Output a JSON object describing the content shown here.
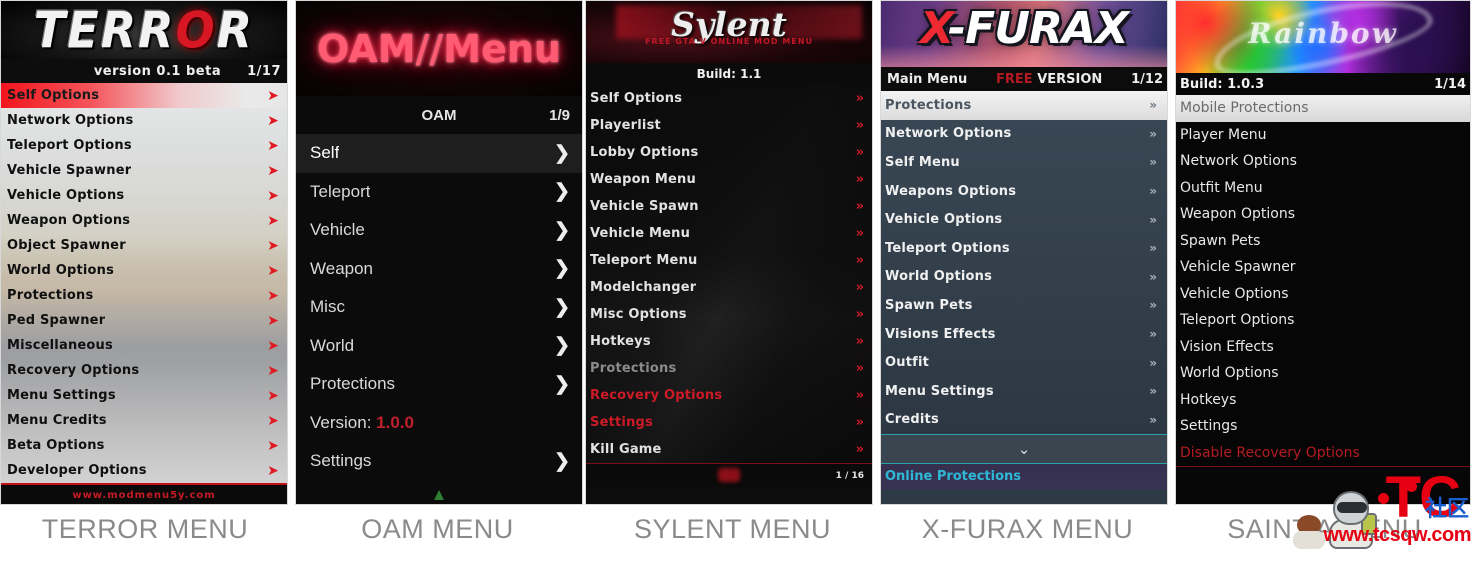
{
  "page": {
    "watermark": {
      "brand": "TC",
      "brand_cn": "社区",
      "url": "www.tcsqw.com"
    }
  },
  "panels": [
    {
      "id": "terror",
      "caption": "TERROR MENU",
      "logo": {
        "pre": "TERR",
        "accent": "O",
        "post": "R"
      },
      "header": {
        "version": "version 0.1 beta",
        "page": "1/17"
      },
      "footer": "www.modmenu5y.com",
      "items": [
        {
          "label": "Self Options",
          "arrow": "➤",
          "selected": true
        },
        {
          "label": "Network Options",
          "arrow": "➤",
          "selected": false
        },
        {
          "label": "Teleport Options",
          "arrow": "➤",
          "selected": false
        },
        {
          "label": "Vehicle Spawner",
          "arrow": "➤",
          "selected": false
        },
        {
          "label": "Vehicle Options",
          "arrow": "➤",
          "selected": false
        },
        {
          "label": "Weapon Options",
          "arrow": "➤",
          "selected": false
        },
        {
          "label": "Object Spawner",
          "arrow": "➤",
          "selected": false
        },
        {
          "label": "World Options",
          "arrow": "➤",
          "selected": false
        },
        {
          "label": "Protections",
          "arrow": "➤",
          "selected": false
        },
        {
          "label": "Ped Spawner",
          "arrow": "➤",
          "selected": false
        },
        {
          "label": "Miscellaneous",
          "arrow": "➤",
          "selected": false
        },
        {
          "label": "Recovery Options",
          "arrow": "➤",
          "selected": false
        },
        {
          "label": "Menu Settings",
          "arrow": "➤",
          "selected": false
        },
        {
          "label": "Menu Credits",
          "arrow": "➤",
          "selected": false
        },
        {
          "label": "Beta Options",
          "arrow": "➤",
          "selected": false
        },
        {
          "label": "Developer Options",
          "arrow": "➤",
          "selected": false
        }
      ]
    },
    {
      "id": "oam",
      "caption": "OAM MENU",
      "logo": "OAM//Menu",
      "header": {
        "title": "OAM",
        "page": "1/9"
      },
      "footer_glyph": "▲",
      "items": [
        {
          "label": "Self",
          "arrow": "❯",
          "selected": true
        },
        {
          "label": "Teleport",
          "arrow": "❯",
          "selected": false
        },
        {
          "label": "Vehicle",
          "arrow": "❯",
          "selected": false
        },
        {
          "label": "Weapon",
          "arrow": "❯",
          "selected": false
        },
        {
          "label": "Misc",
          "arrow": "❯",
          "selected": false
        },
        {
          "label": "World",
          "arrow": "❯",
          "selected": false
        },
        {
          "label": "Protections",
          "arrow": "❯",
          "selected": false
        },
        {
          "label": "Version:",
          "value": "1.0.0",
          "arrow": "",
          "selected": false
        },
        {
          "label": "Settings",
          "arrow": "❯",
          "selected": false
        }
      ]
    },
    {
      "id": "sylent",
      "caption": "SYLENT MENU",
      "logo": "Sylent",
      "tagline": "FREE GTA V ONLINE MOD MENU",
      "header": {
        "build": "Build: 1.1"
      },
      "footer": {
        "page": "1 / 16"
      },
      "items": [
        {
          "label": "Self Options",
          "arrow": "»",
          "style": "normal"
        },
        {
          "label": "Playerlist",
          "arrow": "»",
          "style": "normal"
        },
        {
          "label": "Lobby Options",
          "arrow": "»",
          "style": "normal"
        },
        {
          "label": "Weapon Menu",
          "arrow": "»",
          "style": "normal"
        },
        {
          "label": "Vehicle Spawn",
          "arrow": "»",
          "style": "normal"
        },
        {
          "label": "Vehicle Menu",
          "arrow": "»",
          "style": "normal"
        },
        {
          "label": "Teleport Menu",
          "arrow": "»",
          "style": "normal"
        },
        {
          "label": "Modelchanger",
          "arrow": "»",
          "style": "normal"
        },
        {
          "label": "Misc Options",
          "arrow": "»",
          "style": "normal"
        },
        {
          "label": "Hotkeys",
          "arrow": "»",
          "style": "normal"
        },
        {
          "label": "Protections",
          "arrow": "»",
          "style": "dim"
        },
        {
          "label": "Recovery Options",
          "arrow": "»",
          "style": "red"
        },
        {
          "label": "Settings",
          "arrow": "»",
          "style": "red"
        },
        {
          "label": "Kill Game",
          "arrow": "»",
          "style": "normal"
        }
      ]
    },
    {
      "id": "xfurax",
      "caption": "X-FURAX MENU",
      "logo": {
        "x": "X",
        "rest": "-FURAX"
      },
      "header": {
        "title": "Main Menu",
        "free": "FREE",
        "version": " VERSION",
        "page": "1/12"
      },
      "scroll_glyph": "⌄",
      "footer": "Online Protections",
      "items": [
        {
          "label": "Protections",
          "arrow": "»",
          "selected": true
        },
        {
          "label": "Network Options",
          "arrow": "»",
          "selected": false
        },
        {
          "label": "Self Menu",
          "arrow": "»",
          "selected": false
        },
        {
          "label": "Weapons Options",
          "arrow": "»",
          "selected": false
        },
        {
          "label": "Vehicle Options",
          "arrow": "»",
          "selected": false
        },
        {
          "label": "Teleport Options",
          "arrow": "»",
          "selected": false
        },
        {
          "label": "World Options",
          "arrow": "»",
          "selected": false
        },
        {
          "label": "Spawn Pets",
          "arrow": "»",
          "selected": false
        },
        {
          "label": "Visions Effects",
          "arrow": "»",
          "selected": false
        },
        {
          "label": "Outfit",
          "arrow": "»",
          "selected": false
        },
        {
          "label": "Menu Settings",
          "arrow": "»",
          "selected": false
        },
        {
          "label": "Credits",
          "arrow": "»",
          "selected": false
        }
      ]
    },
    {
      "id": "saint",
      "caption": "SAINT A MENU",
      "logo": "Rainbow",
      "header": {
        "build": "Build: 1.0.3",
        "page": "1/14"
      },
      "items": [
        {
          "label": "Mobile Protections",
          "style": "selected"
        },
        {
          "label": "Player Menu",
          "style": "normal"
        },
        {
          "label": "Network Options",
          "style": "normal"
        },
        {
          "label": "Outfit Menu",
          "style": "normal"
        },
        {
          "label": "Weapon Options",
          "style": "normal"
        },
        {
          "label": "Spawn Pets",
          "style": "normal"
        },
        {
          "label": "Vehicle Spawner",
          "style": "normal"
        },
        {
          "label": "Vehicle Options",
          "style": "normal"
        },
        {
          "label": "Teleport Options",
          "style": "normal"
        },
        {
          "label": "Vision Effects",
          "style": "normal"
        },
        {
          "label": "World Options",
          "style": "normal"
        },
        {
          "label": "Hotkeys",
          "style": "normal"
        },
        {
          "label": "Settings",
          "style": "normal"
        },
        {
          "label": "Disable Recovery Options",
          "style": "red"
        }
      ]
    }
  ]
}
